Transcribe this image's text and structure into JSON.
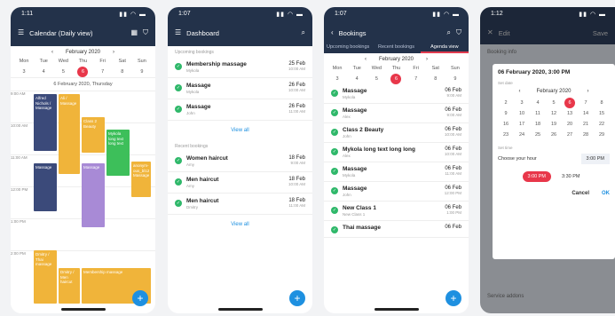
{
  "p1": {
    "time": "1:11",
    "title": "Calendar (Daily view)",
    "month": "February 2020",
    "days": [
      "Mon",
      "Tue",
      "Wed",
      "Thu",
      "Fri",
      "Sat",
      "Sun"
    ],
    "dates": [
      "3",
      "4",
      "5",
      "6",
      "7",
      "8",
      "9"
    ],
    "dayheader": "6 February 2020, Thursday",
    "hours": [
      "9:00 AM",
      "10:00 AM",
      "11:00 AM",
      "12:00 PM",
      "1:00 PM",
      "2:00 PM"
    ],
    "events": [
      "Alfred Nichols / Massage",
      "Ali / Massage",
      "Class 2 Beauty",
      "Mykola long text long text",
      "Massage",
      "Massage",
      "anonym-ous_bl12 Massage",
      "Dmitry / Thai massage",
      "Dmitry / Men haircut",
      "Membership massage"
    ]
  },
  "p2": {
    "time": "1:07",
    "title": "Dashboard",
    "upcoming": "Upcoming bookings",
    "recent": "Recent bookings",
    "viewall": "View all",
    "up": [
      {
        "n": "Membership massage",
        "s": "Mykola",
        "d": "25 Feb",
        "t": "10:00 AM"
      },
      {
        "n": "Massage",
        "s": "Mykola",
        "d": "26 Feb",
        "t": "10:00 AM"
      },
      {
        "n": "Massage",
        "s": "John",
        "d": "26 Feb",
        "t": "11:00 AM"
      }
    ],
    "rec": [
      {
        "n": "Women haircut",
        "s": "Amy",
        "d": "18 Feb",
        "t": "9:00 AM"
      },
      {
        "n": "Men haircut",
        "s": "Amy",
        "d": "18 Feb",
        "t": "10:00 AM"
      },
      {
        "n": "Men haircut",
        "s": "Dmitry",
        "d": "18 Feb",
        "t": "11:00 AM"
      }
    ]
  },
  "p3": {
    "time": "1:07",
    "title": "Bookings",
    "tabs": [
      "Upcoming bookings",
      "Recent bookings",
      "Agenda view"
    ],
    "month": "February 2020",
    "items": [
      {
        "n": "Massage",
        "s": "Mykola",
        "d": "06 Feb",
        "t": "9:00 AM"
      },
      {
        "n": "Massage",
        "s": "Alex",
        "d": "06 Feb",
        "t": "9:00 AM"
      },
      {
        "n": "Class 2 Beauty",
        "s": "John",
        "d": "06 Feb",
        "t": "10:00 AM"
      },
      {
        "n": "Mykola long text long long",
        "s": "Alex",
        "d": "06 Feb",
        "t": "10:00 AM"
      },
      {
        "n": "Massage",
        "s": "Mykola",
        "d": "06 Feb",
        "t": "11:00 AM"
      },
      {
        "n": "Massage",
        "s": "John",
        "d": "06 Feb",
        "t": "12:00 PM"
      },
      {
        "n": "New Class 1",
        "s": "New Class 1",
        "d": "06 Feb",
        "t": "1:00 PM"
      },
      {
        "n": "Thai massage",
        "s": "",
        "d": "06 Feb",
        "t": ""
      }
    ]
  },
  "p4": {
    "time": "1:12",
    "edit": "Edit",
    "save": "Save",
    "info": "Booking info",
    "dialog_title": "06 February 2020, 3:00 PM",
    "setdate": "Set date",
    "month": "February 2020",
    "settime": "Set time",
    "hourlbl": "Choose your hour",
    "hourval": "3:00 PM",
    "slot1": "3:00 PM",
    "slot2": "3:30 PM",
    "cancel": "Cancel",
    "ok": "OK",
    "service": "Service addons",
    "cal": [
      [
        "2",
        "3",
        "4",
        "5",
        "6",
        "7",
        "8"
      ],
      [
        "9",
        "10",
        "11",
        "12",
        "13",
        "14",
        "15"
      ],
      [
        "16",
        "17",
        "18",
        "19",
        "20",
        "21",
        "22"
      ],
      [
        "23",
        "24",
        "25",
        "26",
        "27",
        "28",
        "29"
      ]
    ]
  }
}
